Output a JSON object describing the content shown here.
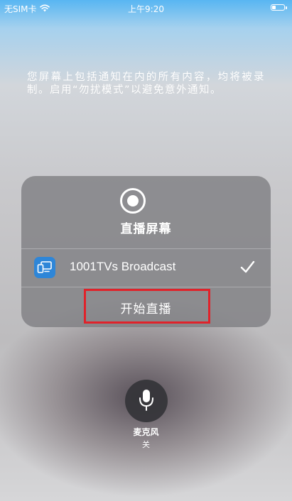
{
  "status_bar": {
    "carrier": "无SIM卡",
    "time": "上午9:20",
    "wifi_icon": "wifi-icon",
    "battery_icon": "battery-icon"
  },
  "notice": "您屏幕上包括通知在内的所有内容，均将被录制。启用“勿扰模式”以避免意外通知。",
  "panel": {
    "title": "直播屏幕",
    "record_icon": "record-icon",
    "extension": {
      "name": "1001TVs Broadcast",
      "icon": "screen-mirror-icon",
      "selected": true,
      "check_icon": "checkmark-icon"
    },
    "start_label": "开始直播"
  },
  "microphone": {
    "icon": "microphone-icon",
    "label": "麦克风",
    "state": "关"
  },
  "colors": {
    "highlight": "#e0222a",
    "app_icon": "#2e86d8"
  }
}
